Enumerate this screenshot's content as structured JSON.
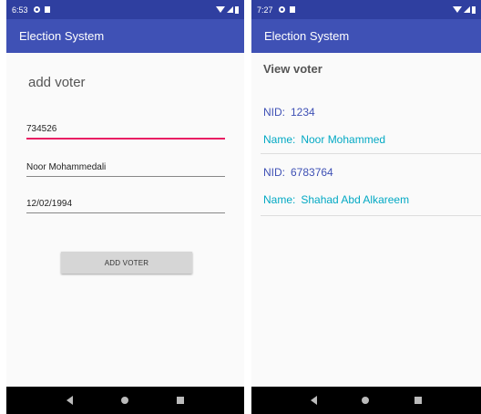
{
  "left_screen": {
    "status_bar": {
      "time": "6:53"
    },
    "app_bar": {
      "title": "Election System"
    },
    "form": {
      "title": "add voter",
      "nid_value": "734526",
      "name_value": "Noor Mohammedali",
      "dob_value": "12/02/1994",
      "submit_label": "ADD VOTER"
    }
  },
  "right_screen": {
    "status_bar": {
      "time": "7:27"
    },
    "app_bar": {
      "title": "Election System"
    },
    "list": {
      "title": "View voter",
      "nid_label": "NID:",
      "name_label": "Name:",
      "items": [
        {
          "nid": "1234",
          "name": "Noor Mohammed"
        },
        {
          "nid": "6783764",
          "name": "Shahad Abd Alkareem"
        }
      ]
    }
  },
  "colors": {
    "primary": "#3f51b5",
    "primary_dark": "#2f3fa0",
    "accent": "#e91e63",
    "nid_text": "#3f51b5",
    "name_text": "#03a9c4"
  },
  "icons": [
    "gear-icon",
    "sd-card-icon",
    "wifi-icon",
    "signal-icon",
    "battery-icon",
    "nav-back-icon",
    "nav-home-icon",
    "nav-recent-icon"
  ]
}
